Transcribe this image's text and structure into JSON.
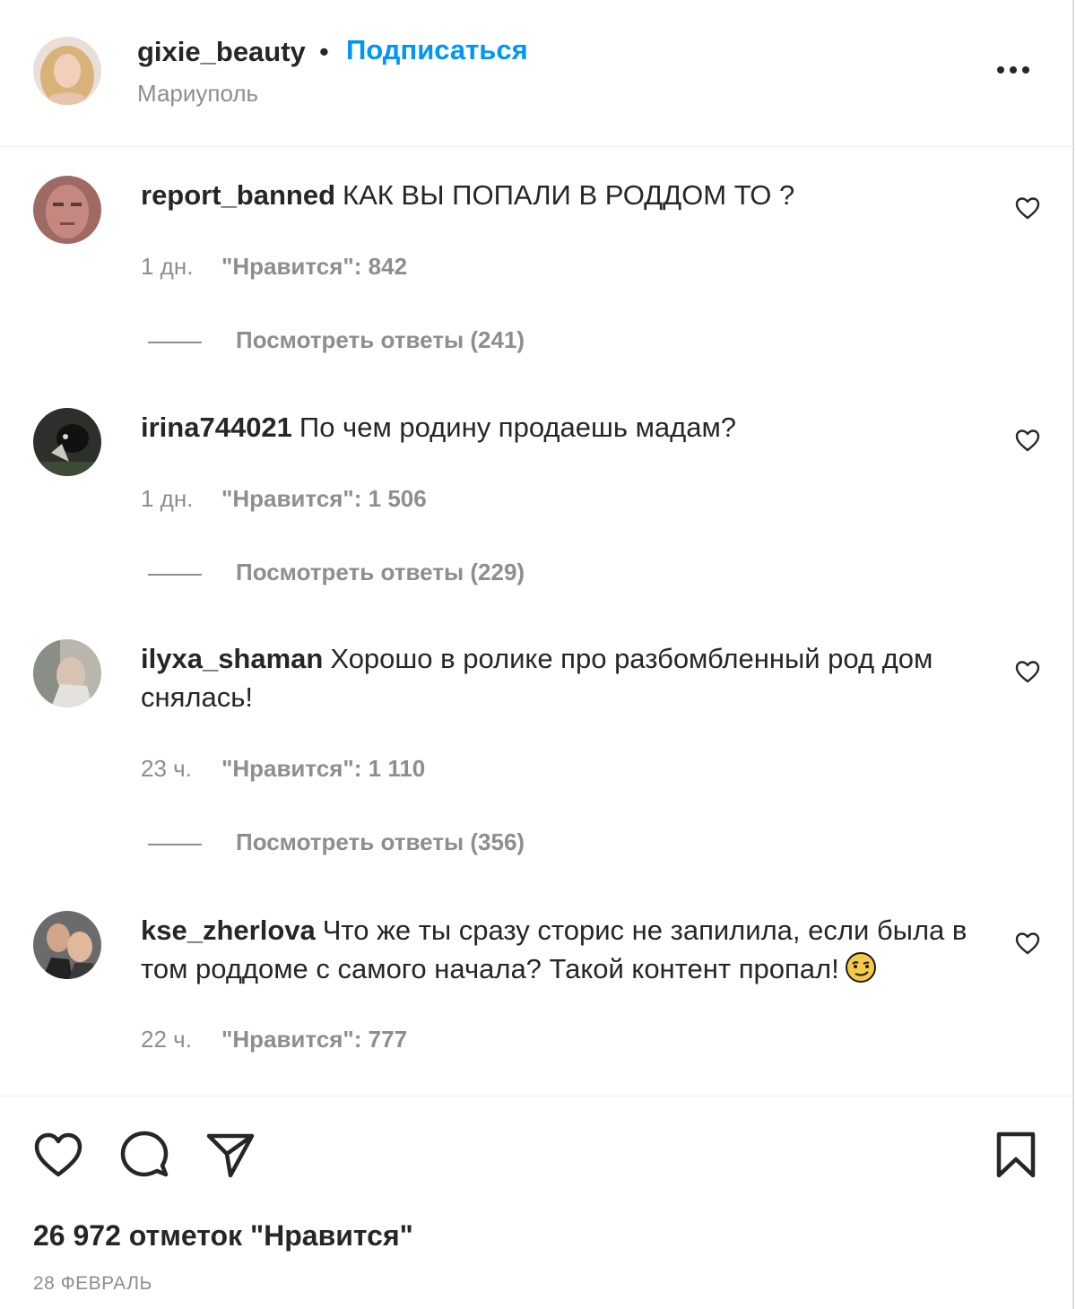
{
  "post": {
    "username": "gixie_beauty",
    "separator": "•",
    "follow_label": "Подписаться",
    "location": "Мариуполь",
    "more_icon": "more-horizontal-icon"
  },
  "comments": [
    {
      "username": "report_banned",
      "text": "КАК ВЫ ПОПАЛИ В РОДДОМ ТО ?",
      "time": "1 дн.",
      "likes": "\"Нравится\": 842",
      "replies": "Посмотреть ответы (241)"
    },
    {
      "username": "irina744021",
      "text": "По чем родину продаешь мадам?",
      "time": "1 дн.",
      "likes": "\"Нравится\": 1 506",
      "replies": "Посмотреть ответы (229)"
    },
    {
      "username": "ilyxa_shaman",
      "text": "Хорошо в ролике про разбомбленный род дом снялась!",
      "time": "23 ч.",
      "likes": "\"Нравится\": 1 110",
      "replies": "Посмотреть ответы (356)"
    },
    {
      "username": "kse_zherlova",
      "text": "Что же ты сразу сторис не запилила, если была в том роддоме с самого начала? Такой контент пропал!",
      "emoji": "smirk-emoji",
      "time": "22 ч.",
      "likes": "\"Нравится\": 777"
    }
  ],
  "actions": {
    "like_icon": "heart-icon",
    "comment_icon": "comment-icon",
    "share_icon": "paper-plane-icon",
    "save_icon": "bookmark-icon"
  },
  "likes_total": "26 972 отметок \"Нравится\"",
  "date": "28 ФЕВРАЛЬ",
  "colors": {
    "accent": "#0095f6",
    "text": "#262626",
    "secondary": "#8e8e8e"
  }
}
